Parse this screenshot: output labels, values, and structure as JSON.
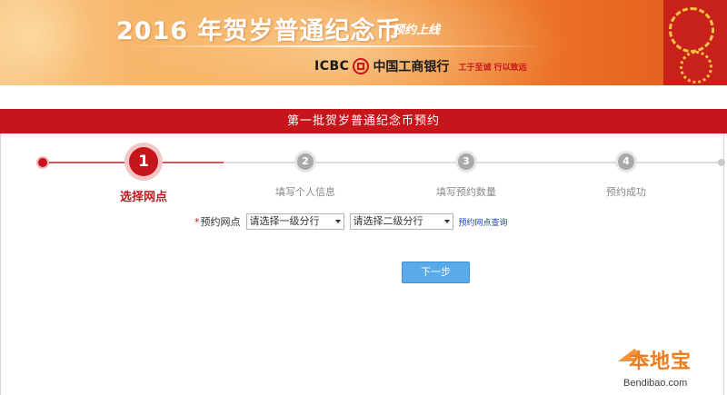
{
  "banner": {
    "title": "2016 年贺岁普通纪念币",
    "subtitle": "预约上线",
    "bank_en": "ICBC",
    "bank_cn": "中国工商银行",
    "slogan": "工于至诚 行以致远"
  },
  "header": {
    "title": "第一批贺岁普通纪念币预约"
  },
  "steps": [
    {
      "number": "1",
      "label": "选择网点",
      "active": true
    },
    {
      "number": "2",
      "label": "填写个人信息",
      "active": false
    },
    {
      "number": "3",
      "label": "填写预约数量",
      "active": false
    },
    {
      "number": "4",
      "label": "预约成功",
      "active": false
    }
  ],
  "form": {
    "required_mark": "*",
    "label": "预约网点",
    "select_primary": "请选择一级分行",
    "select_secondary": "请选择二级分行",
    "link": "预约网点查询"
  },
  "actions": {
    "next_label": "下一步"
  },
  "watermark": {
    "title": "本地宝",
    "domain": "Bendibao.com"
  },
  "colors": {
    "brand_red": "#c7151c",
    "button_blue": "#5aa9e9",
    "step_inactive": "#a9a9a9",
    "banner_orange": "#f08f37"
  }
}
